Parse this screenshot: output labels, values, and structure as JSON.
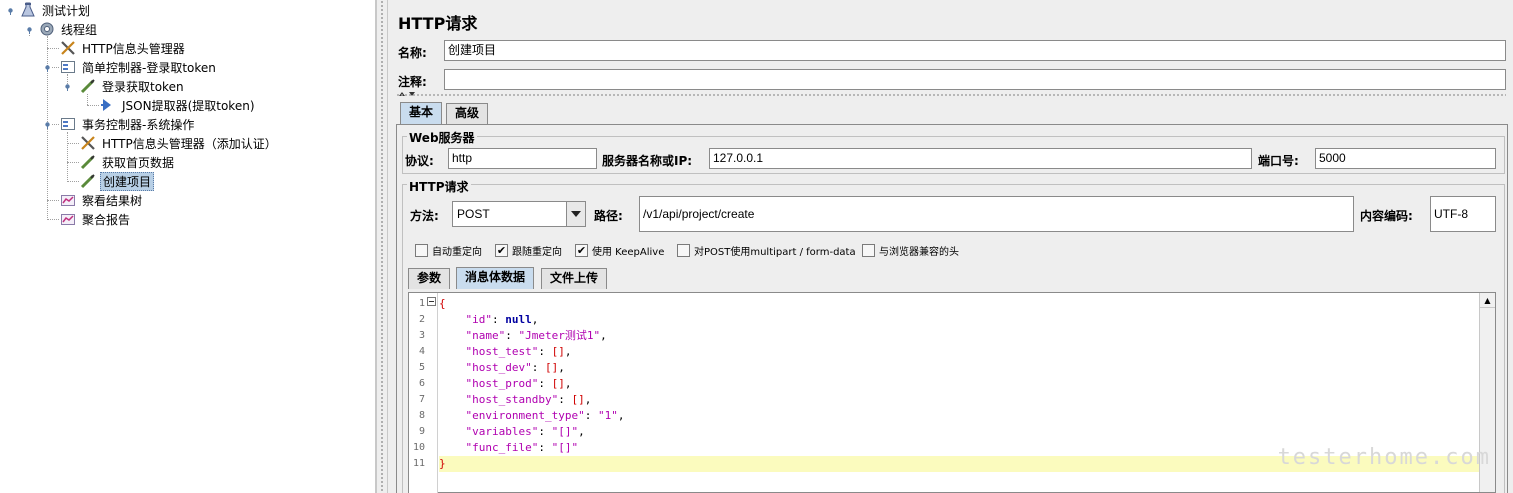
{
  "tree": {
    "items": [
      {
        "label": "测试计划",
        "icon": "test-plan-icon"
      },
      {
        "label": "线程组",
        "icon": "gear-icon"
      },
      {
        "label": "HTTP信息头管理器",
        "icon": "wrench-icon"
      },
      {
        "label": "简单控制器-登录取token",
        "icon": "controller-icon"
      },
      {
        "label": "登录获取token",
        "icon": "sampler-pen-icon"
      },
      {
        "label": "JSON提取器(提取token)",
        "icon": "extractor-arrow-icon"
      },
      {
        "label": "事务控制器-系统操作",
        "icon": "controller-icon"
      },
      {
        "label": "HTTP信息头管理器（添加认证）",
        "icon": "wrench-icon"
      },
      {
        "label": "获取首页数据",
        "icon": "sampler-pen-icon"
      },
      {
        "label": "创建项目",
        "icon": "sampler-pen-icon"
      },
      {
        "label": "察看结果树",
        "icon": "listener-chart-icon"
      },
      {
        "label": "聚合报告",
        "icon": "listener-chart-icon"
      }
    ],
    "selected": "创建项目"
  },
  "panel": {
    "title": "HTTP请求",
    "name_label": "名称:",
    "name_value": "创建项目",
    "comment_label": "注释:",
    "comment_value": "",
    "tabs": [
      {
        "label": "基本"
      },
      {
        "label": "高级"
      }
    ],
    "active_tab": "基本",
    "web_server": {
      "title": "Web服务器",
      "protocol_label": "协议:",
      "protocol_value": "http",
      "server_label": "服务器名称或IP:",
      "server_value": "127.0.0.1",
      "port_label": "端口号:",
      "port_value": "5000"
    },
    "http_request": {
      "title": "HTTP请求",
      "method_label": "方法:",
      "method_value": "POST",
      "path_label": "路径:",
      "path_value": "/v1/api/project/create",
      "encoding_label": "内容编码:",
      "encoding_value": "UTF-8"
    },
    "checkboxes": [
      {
        "label": "自动重定向",
        "checked": false
      },
      {
        "label": "跟随重定向",
        "checked": true
      },
      {
        "label": "使用 KeepAlive",
        "checked": true
      },
      {
        "label": "对POST使用multipart / form-data",
        "checked": false
      },
      {
        "label": "与浏览器兼容的头",
        "checked": false
      }
    ],
    "body_tabs": [
      {
        "label": "参数"
      },
      {
        "label": "消息体数据"
      },
      {
        "label": "文件上传"
      }
    ],
    "active_body_tab": "消息体数据"
  },
  "editor": {
    "line_numbers": [
      "1",
      "2",
      "3",
      "4",
      "5",
      "6",
      "7",
      "8",
      "9",
      "10",
      "11"
    ],
    "lines": [
      [
        {
          "t": "br",
          "v": "{"
        }
      ],
      [
        {
          "t": "p",
          "v": "    "
        },
        {
          "t": "k",
          "v": "\"id\""
        },
        {
          "t": "p",
          "v": ": "
        },
        {
          "t": "n",
          "v": "null"
        },
        {
          "t": "p",
          "v": ","
        }
      ],
      [
        {
          "t": "p",
          "v": "    "
        },
        {
          "t": "k",
          "v": "\"name\""
        },
        {
          "t": "p",
          "v": ": "
        },
        {
          "t": "s",
          "v": "\"Jmeter测试1\""
        },
        {
          "t": "p",
          "v": ","
        }
      ],
      [
        {
          "t": "p",
          "v": "    "
        },
        {
          "t": "k",
          "v": "\"host_test\""
        },
        {
          "t": "p",
          "v": ": "
        },
        {
          "t": "br",
          "v": "[]"
        },
        {
          "t": "p",
          "v": ","
        }
      ],
      [
        {
          "t": "p",
          "v": "    "
        },
        {
          "t": "k",
          "v": "\"host_dev\""
        },
        {
          "t": "p",
          "v": ": "
        },
        {
          "t": "br",
          "v": "[]"
        },
        {
          "t": "p",
          "v": ","
        }
      ],
      [
        {
          "t": "p",
          "v": "    "
        },
        {
          "t": "k",
          "v": "\"host_prod\""
        },
        {
          "t": "p",
          "v": ": "
        },
        {
          "t": "br",
          "v": "[]"
        },
        {
          "t": "p",
          "v": ","
        }
      ],
      [
        {
          "t": "p",
          "v": "    "
        },
        {
          "t": "k",
          "v": "\"host_standby\""
        },
        {
          "t": "p",
          "v": ": "
        },
        {
          "t": "br",
          "v": "[]"
        },
        {
          "t": "p",
          "v": ","
        }
      ],
      [
        {
          "t": "p",
          "v": "    "
        },
        {
          "t": "k",
          "v": "\"environment_type\""
        },
        {
          "t": "p",
          "v": ": "
        },
        {
          "t": "s",
          "v": "\"1\""
        },
        {
          "t": "p",
          "v": ","
        }
      ],
      [
        {
          "t": "p",
          "v": "    "
        },
        {
          "t": "k",
          "v": "\"variables\""
        },
        {
          "t": "p",
          "v": ": "
        },
        {
          "t": "s",
          "v": "\"[]\""
        },
        {
          "t": "p",
          "v": ","
        }
      ],
      [
        {
          "t": "p",
          "v": "    "
        },
        {
          "t": "k",
          "v": "\"func_file\""
        },
        {
          "t": "p",
          "v": ": "
        },
        {
          "t": "s",
          "v": "\"[]\""
        }
      ],
      [
        {
          "t": "br",
          "v": "}"
        }
      ]
    ],
    "highlighted_line": 11
  },
  "watermark": "testerhome.com"
}
